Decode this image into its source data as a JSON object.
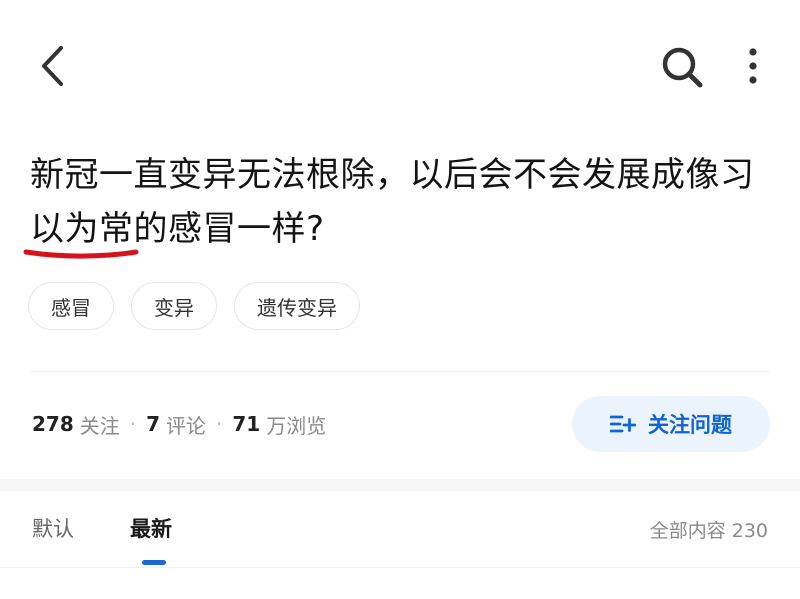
{
  "header": {
    "back_icon": "chevron-left-icon",
    "search_icon": "search-icon",
    "more_icon": "more-vertical-icon"
  },
  "question": {
    "title": "新冠一直变异无法根除，以后会不会发展成像习以为常的感冒一样?",
    "underline_color": "#d8121a"
  },
  "tags": [
    {
      "label": "感冒"
    },
    {
      "label": "变异"
    },
    {
      "label": "遗传变异"
    }
  ],
  "stats": {
    "followers_count": "278",
    "followers_label": "关注",
    "comments_count": "7",
    "comments_label": "评论",
    "views_count": "71",
    "views_label": "万浏览",
    "separator": "·"
  },
  "follow_button": {
    "label": "关注问题",
    "icon": "follow-list-plus-icon",
    "color": "#0f63d6",
    "background": "#ebf3fd"
  },
  "sort": {
    "default_label": "默认",
    "latest_label": "最新",
    "active": "最新",
    "all_content_label": "全部内容 230",
    "indicator_color": "#1a66d4"
  }
}
